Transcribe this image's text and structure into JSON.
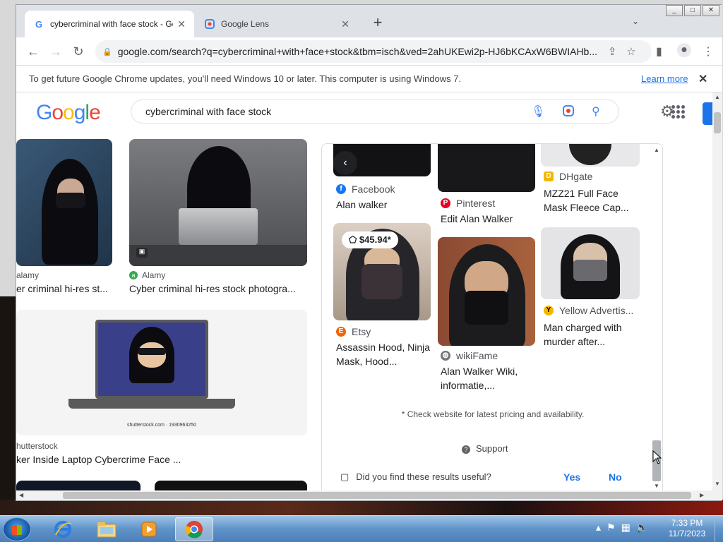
{
  "browser": {
    "tabs": [
      {
        "title": "cybercriminal with face stock - Go",
        "favicon": "google-g-icon"
      },
      {
        "title": "Google Lens",
        "favicon": "google-lens-icon"
      }
    ],
    "new_tab": "+",
    "url": "google.com/search?q=cybercriminal+with+face+stock&tbm=isch&ved=2ahUKEwi2p-HJ6bKCAxW6BWIAHb...",
    "info_bar": {
      "message": "To get future Google Chrome updates, you'll need Windows 10 or later. This computer is using Windows 7.",
      "link": "Learn more"
    }
  },
  "google": {
    "logo": [
      "G",
      "o",
      "o",
      "g",
      "l",
      "e"
    ],
    "logo_colors": [
      "#4285f4",
      "#ea4335",
      "#fbbc05",
      "#4285f4",
      "#34a853",
      "#ea4335"
    ],
    "query": "cybercriminal with face stock"
  },
  "results": [
    {
      "source": "alamy",
      "caption": "er criminal hi-res st..."
    },
    {
      "source": "Alamy",
      "caption": "Cyber criminal hi-res stock photogra..."
    },
    {
      "source": "hutterstock",
      "caption": "ker Inside Laptop Cybercrime Face ...",
      "watermark": "shutterstock.com · 1930963250"
    }
  ],
  "panel": {
    "cards": [
      {
        "source": "Facebook",
        "caption": "Alan walker"
      },
      {
        "source": "Pinterest",
        "caption": "Edit Alan Walker"
      },
      {
        "source": "DHgate",
        "caption": "MZZ21 Full Face Mask Fleece Cap..."
      },
      {
        "source": "Etsy",
        "caption": "Assassin Hood, Ninja Mask, Hood...",
        "price": "$45.94*"
      },
      {
        "source": "wikiFame",
        "caption": "Alan Walker Wiki, informatie,..."
      },
      {
        "source": "Yellow Advertis...",
        "caption": "Man charged with murder after..."
      }
    ],
    "note": "* Check website for latest pricing and availability.",
    "support": "Support",
    "feedback": "Did you find these results useful?",
    "yes": "Yes",
    "no": "No"
  },
  "taskbar": {
    "time": "7:33 PM",
    "date": "11/7/2023"
  }
}
